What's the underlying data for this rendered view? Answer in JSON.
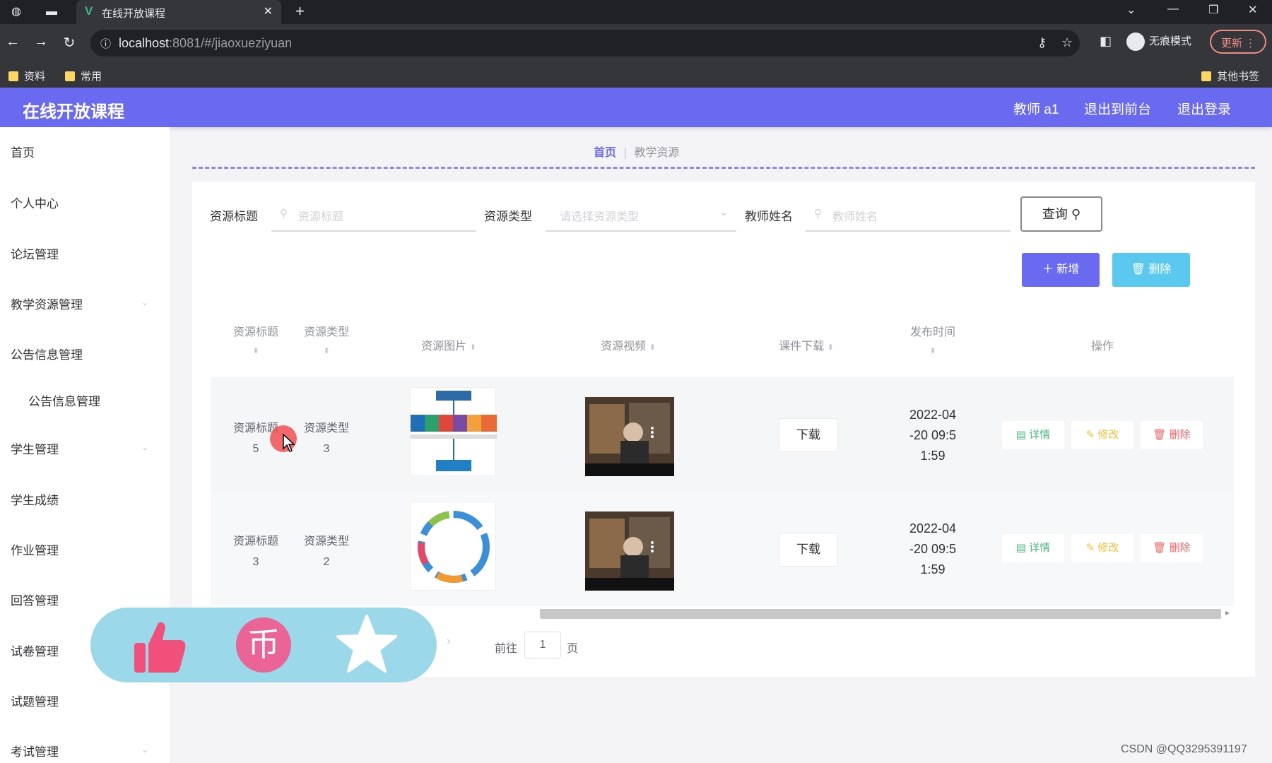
{
  "browser": {
    "tab_title": "在线开放课程",
    "url_host": "localhost",
    "url_path": ":8081/#/jiaoxueziyuan",
    "profile_label": "无痕模式",
    "update_label": "更新",
    "bookmarks": [
      "资料",
      "常用"
    ],
    "other_bookmarks": "其他书签"
  },
  "header": {
    "title": "在线开放课程",
    "user": "教师 a1",
    "back_front": "退出到前台",
    "logout": "退出登录"
  },
  "sidebar": {
    "items": [
      "首页",
      "个人中心",
      "论坛管理",
      "教学资源管理",
      "公告信息管理",
      "公告信息管理",
      "学生管理",
      "学生成绩",
      "作业管理",
      "回答管理",
      "试卷管理",
      "试题管理",
      "考试管理"
    ]
  },
  "breadcrumb": {
    "home": "首页",
    "current": "教学资源"
  },
  "search": {
    "title_label": "资源标题",
    "title_placeholder": "资源标题",
    "type_label": "资源类型",
    "type_placeholder": "请选择资源类型",
    "teacher_label": "教师姓名",
    "teacher_placeholder": "教师姓名",
    "query_button": "查询"
  },
  "actions": {
    "add": "新增",
    "delete": "删除"
  },
  "table": {
    "headers": [
      "资源标题",
      "资源类型",
      "资源图片",
      "资源视频",
      "课件下载",
      "发布时间",
      "操作"
    ],
    "rows": [
      {
        "title": "资源标题",
        "title_num": "5",
        "type": "资源类型",
        "type_num": "3",
        "download": "下载",
        "time": [
          "2022-04",
          "-20 09:5",
          "1:59"
        ],
        "op_detail": "详情",
        "op_edit": "修改",
        "op_delete": "删除"
      },
      {
        "title": "资源标题",
        "title_num": "3",
        "type": "资源类型",
        "type_num": "2",
        "download": "下载",
        "time": [
          "2022-04",
          "-20 09:5",
          "1:59"
        ],
        "op_detail": "详情",
        "op_edit": "修改",
        "op_delete": "删除"
      }
    ]
  },
  "pager": {
    "goto": "前往",
    "page_value": "1",
    "page_unit": "页"
  },
  "watermark": "CSDN @QQ3295391197",
  "colors": {
    "accent": "#6a6af0",
    "danger": "#f06262",
    "success": "#4cbb7f",
    "warning": "#f3c13a",
    "info": "#5bc8f0"
  }
}
